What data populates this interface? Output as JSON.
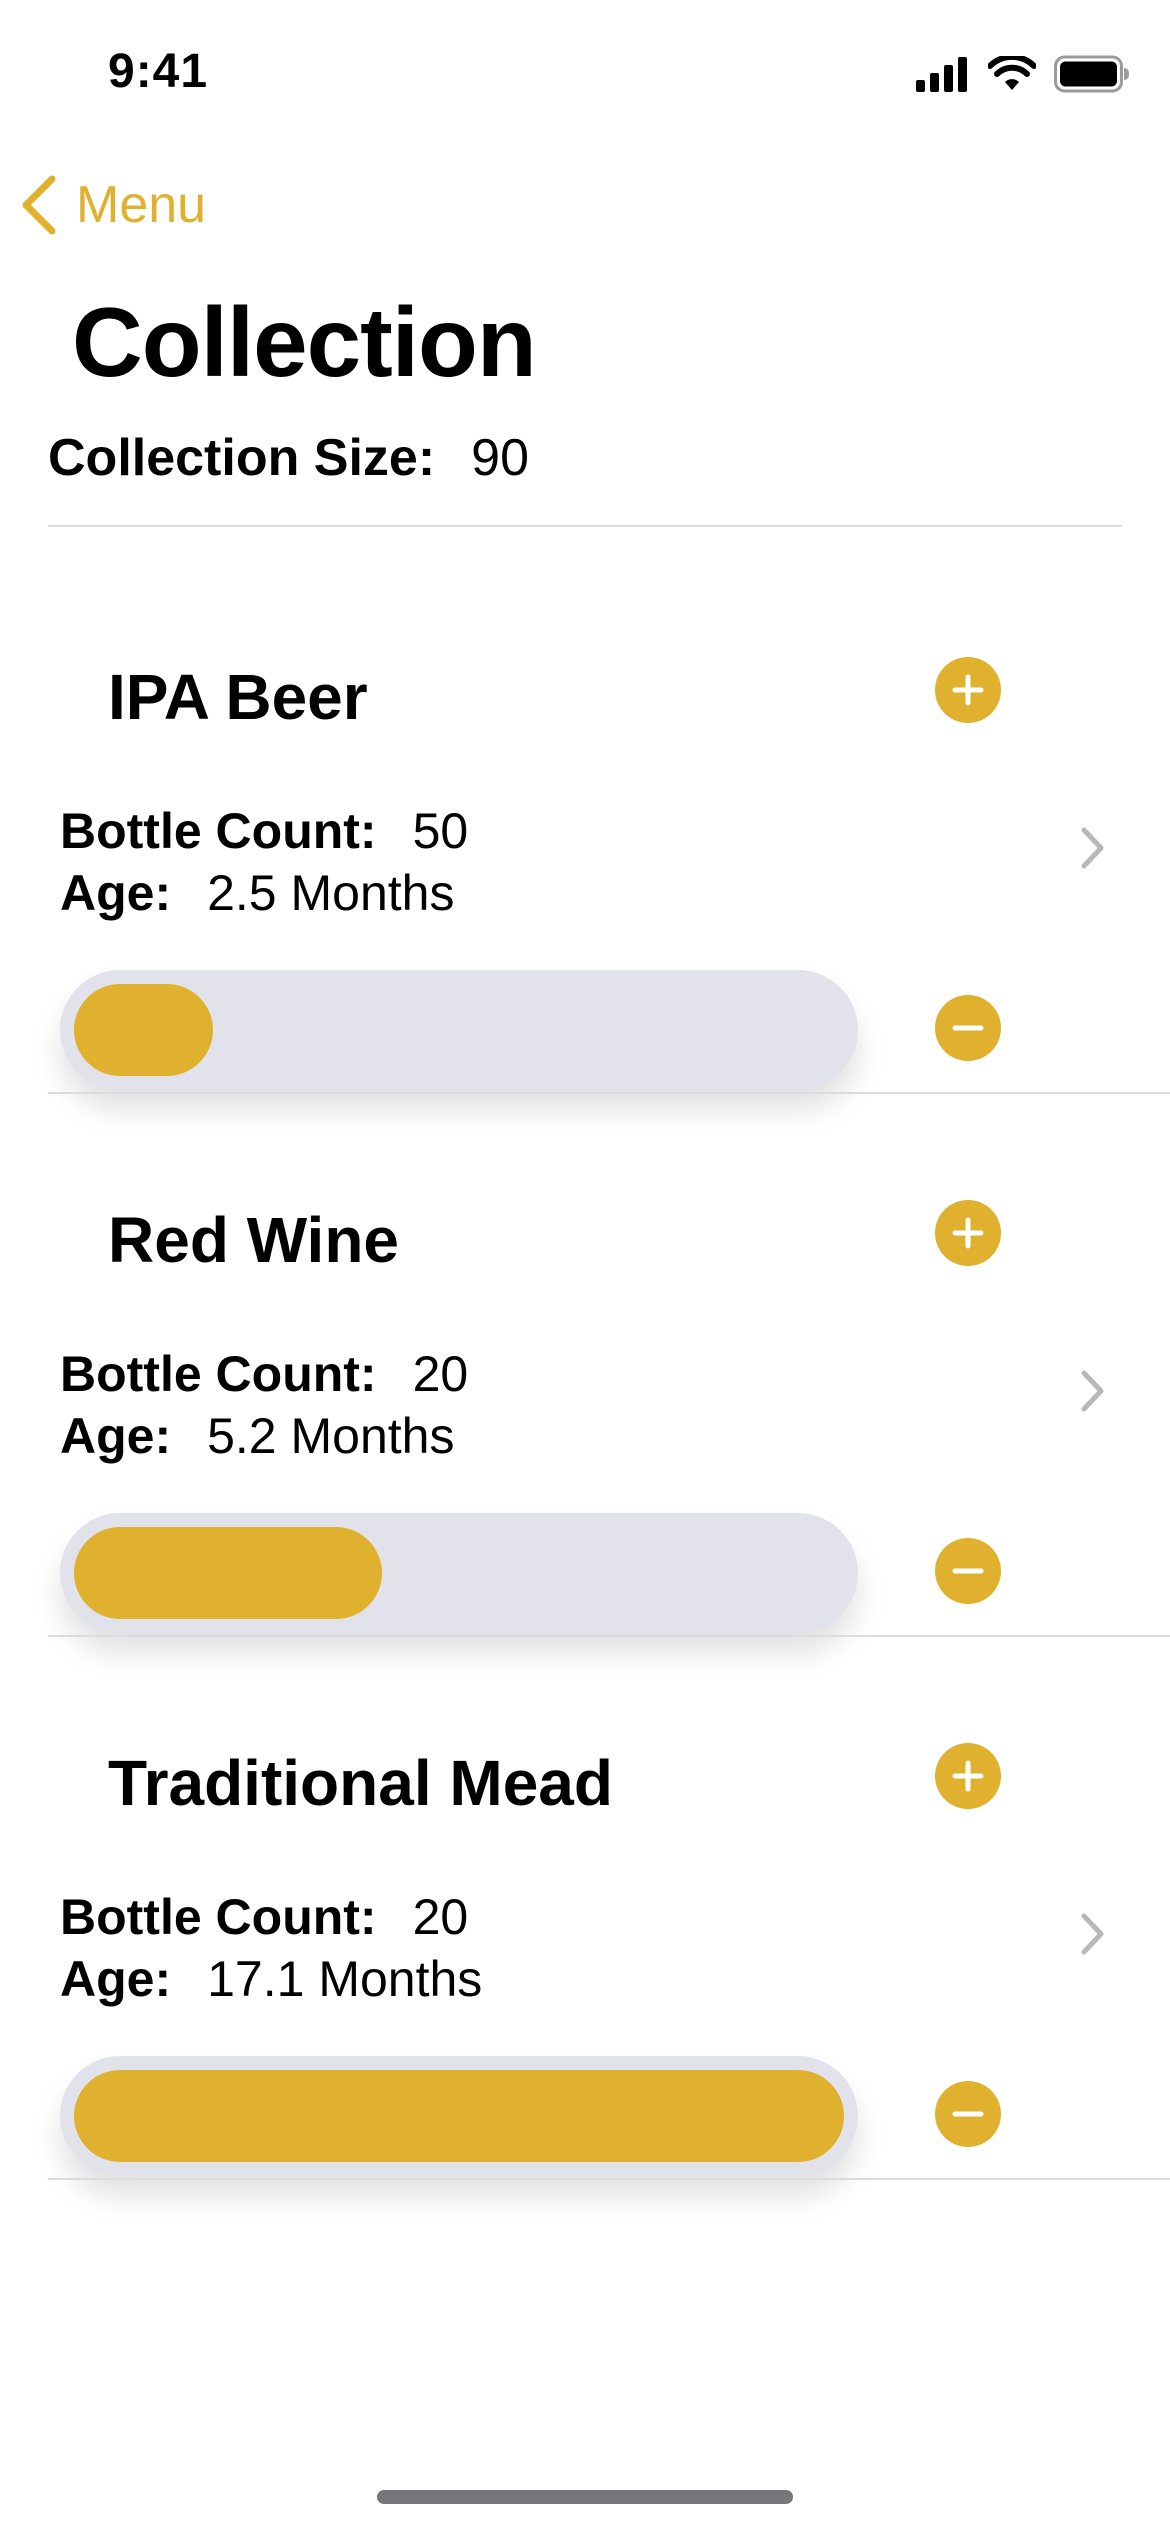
{
  "status_bar": {
    "time": "9:41"
  },
  "nav": {
    "back_label": "Menu"
  },
  "page": {
    "title": "Collection",
    "collection_size_label": "Collection Size:",
    "collection_size_value": "90"
  },
  "colors": {
    "accent": "#E0B12E",
    "track": "#E2E2EA",
    "divider": "#DCDCDE"
  },
  "items": [
    {
      "name": "IPA Beer",
      "bottle_count_label": "Bottle Count:",
      "bottle_count": "50",
      "age_label": "Age:",
      "age": "2.5 Months",
      "progress": 0.18
    },
    {
      "name": "Red Wine",
      "bottle_count_label": "Bottle Count:",
      "bottle_count": "20",
      "age_label": "Age:",
      "age": "5.2 Months",
      "progress": 0.4
    },
    {
      "name": "Traditional Mead",
      "bottle_count_label": "Bottle Count:",
      "bottle_count": "20",
      "age_label": "Age:",
      "age": "17.1 Months",
      "progress": 1.0
    }
  ]
}
